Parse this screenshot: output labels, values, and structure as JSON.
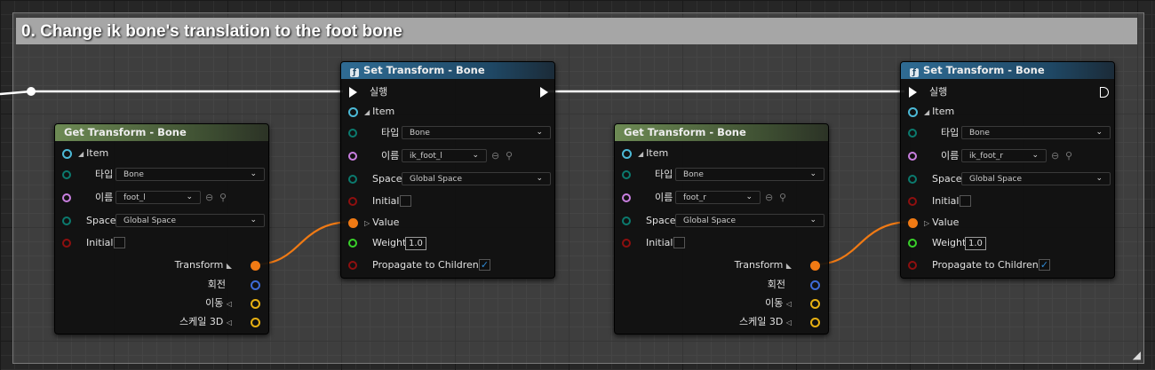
{
  "comment": {
    "title": "0. Change ik bone's translation to the foot bone"
  },
  "get_transform_left": {
    "title": "Get Transform - Bone",
    "item_label": "Item",
    "type_label": "타입",
    "type_value": "Bone",
    "name_label": "이름",
    "name_value": "foot_l",
    "space_label": "Space",
    "space_value": "Global Space",
    "initial_label": "Initial",
    "out_transform": "Transform",
    "out_rotation": "회전",
    "out_translation": "이동",
    "out_scale": "스케일 3D"
  },
  "set_transform_left": {
    "title": "Set Transform - Bone",
    "exec_label": "실행",
    "item_label": "Item",
    "type_label": "타입",
    "type_value": "Bone",
    "name_label": "이름",
    "name_value": "ik_foot_l",
    "space_label": "Space",
    "space_value": "Global Space",
    "initial_label": "Initial",
    "value_label": "Value",
    "weight_label": "Weight",
    "weight_value": "1.0",
    "propagate_label": "Propagate to Children",
    "propagate_checked": true
  },
  "get_transform_right": {
    "title": "Get Transform - Bone",
    "item_label": "Item",
    "type_label": "타입",
    "type_value": "Bone",
    "name_label": "이름",
    "name_value": "foot_r",
    "space_label": "Space",
    "space_value": "Global Space",
    "initial_label": "Initial",
    "out_transform": "Transform",
    "out_rotation": "회전",
    "out_translation": "이동",
    "out_scale": "스케일 3D"
  },
  "set_transform_right": {
    "title": "Set Transform - Bone",
    "exec_label": "실행",
    "item_label": "Item",
    "type_label": "타입",
    "type_value": "Bone",
    "name_label": "이름",
    "name_value": "ik_foot_r",
    "space_label": "Space",
    "space_value": "Global Space",
    "initial_label": "Initial",
    "value_label": "Value",
    "weight_label": "Weight",
    "weight_value": "1.0",
    "propagate_label": "Propagate to Children",
    "propagate_checked": true
  },
  "colors": {
    "struct_pin": "#4cb9d6",
    "name_pin": "#c97fe0",
    "enum_pin": "#0b7a6e",
    "bool_pin": "#8e0f0f",
    "float_pin": "#39d12a",
    "transform_pin": "#f07a14",
    "rotator_pin": "#3d6bd6",
    "vector_pin": "#e7b012",
    "wire_transform": "#f07a14",
    "wire_exec": "#ffffff"
  }
}
